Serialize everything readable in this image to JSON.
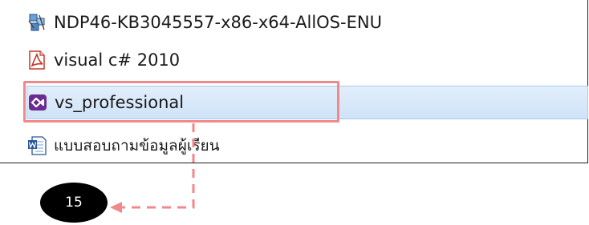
{
  "file_list": {
    "items": [
      {
        "label": "NDP46-KB3045557-x86-x64-AllOS-ENU",
        "icon": "installer-icon"
      },
      {
        "label": "visual c# 2010",
        "icon": "pdf-icon"
      },
      {
        "label": "vs_professional",
        "icon": "visual-studio-icon",
        "selected": true
      },
      {
        "label": "แบบสอบถามข้อมูลผู้เรียน",
        "icon": "word-document-icon"
      }
    ]
  },
  "annotation": {
    "step_number": "15",
    "highlight_color": "#f08a8a",
    "badge_color": "#000000"
  }
}
